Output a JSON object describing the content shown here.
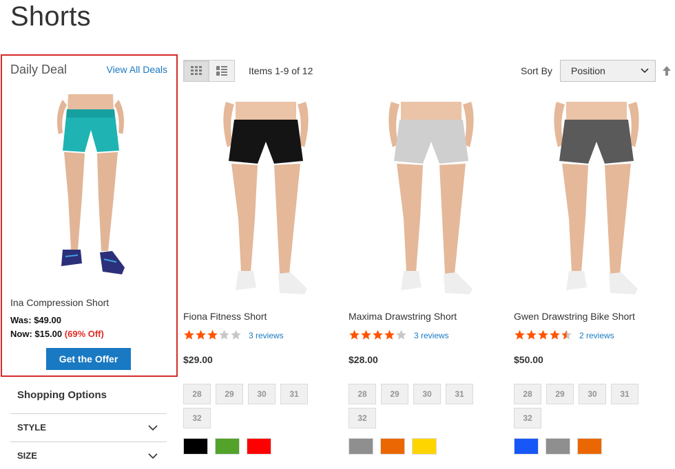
{
  "page": {
    "title": "Shorts"
  },
  "daily_deal": {
    "title": "Daily Deal",
    "view_all": "View All Deals",
    "product_name": "Ina Compression Short",
    "was": "Was: $49.00",
    "now": "Now: $15.00",
    "off": "(69% Off)",
    "button": "Get the Offer",
    "image_icon": "product-photo-teal-shorts"
  },
  "sidebar": {
    "shopping_options": "Shopping Options",
    "filters": [
      {
        "label": "STYLE",
        "icon": "chevron-down-icon"
      },
      {
        "label": "SIZE",
        "icon": "chevron-down-icon"
      }
    ]
  },
  "toolbar": {
    "modes": [
      {
        "name": "Grid",
        "icon": "grid-icon",
        "active": true
      },
      {
        "name": "List",
        "icon": "list-icon",
        "active": false
      }
    ],
    "amount": "Items 1-9 of 12",
    "sort_label": "Sort By",
    "sort_value": "Position",
    "sort_options_visible": [
      "Position"
    ],
    "sort_direction_icon": "arrow-up-icon"
  },
  "colors": {
    "accent": "#1979c3",
    "star": "#ff5501",
    "deal_border": "#d52b2b",
    "discount": "#e02b27"
  },
  "products": [
    {
      "name": "Fiona Fitness Short",
      "rating": 3,
      "reviews": "3 reviews",
      "price": "$29.00",
      "sizes": [
        "28",
        "29",
        "30",
        "31",
        "32"
      ],
      "colors": [
        "#000000",
        "#53a22a",
        "#ff0000"
      ],
      "shorts_color": "#141414"
    },
    {
      "name": "Maxima Drawstring Short",
      "rating": 4,
      "reviews": "3 reviews",
      "price": "$28.00",
      "sizes": [
        "28",
        "29",
        "30",
        "31",
        "32"
      ],
      "colors": [
        "#8f8f8f",
        "#eb6703",
        "#ffd500"
      ],
      "shorts_color": "#cfcfcf"
    },
    {
      "name": "Gwen Drawstring Bike Short",
      "rating": 4.5,
      "reviews": "2 reviews",
      "price": "$50.00",
      "sizes": [
        "28",
        "29",
        "30",
        "31",
        "32"
      ],
      "colors": [
        "#1857f7",
        "#8f8f8f",
        "#eb6703"
      ],
      "shorts_color": "#5a5a5a"
    }
  ]
}
